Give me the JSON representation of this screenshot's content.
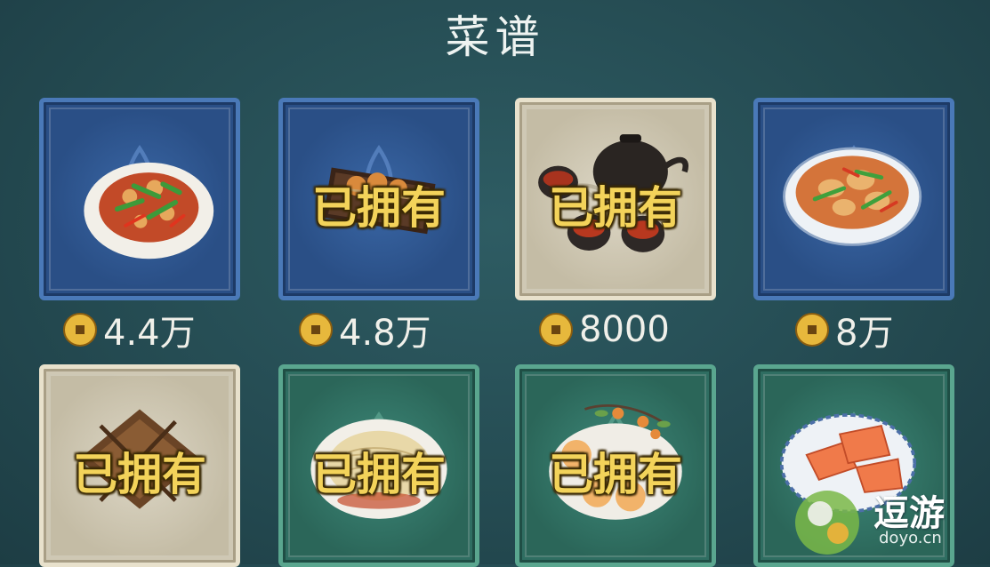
{
  "title": "菜谱",
  "owned_label": "已拥有",
  "recipes": [
    {
      "price": "4.4万",
      "owned": false,
      "frame": "blue"
    },
    {
      "price": "4.8万",
      "owned": true,
      "frame": "blue"
    },
    {
      "price": "8000",
      "owned": true,
      "frame": "beige"
    },
    {
      "price": "8万",
      "owned": false,
      "frame": "blue"
    },
    {
      "owned": true,
      "frame": "beige"
    },
    {
      "owned": true,
      "frame": "teal"
    },
    {
      "owned": true,
      "frame": "teal"
    },
    {
      "owned": false,
      "frame": "teal"
    }
  ],
  "watermark": {
    "brand": "逗游",
    "site": "doyo.cn"
  },
  "colors": {
    "owned_text": "#f3d35a",
    "background": "#2a555c"
  },
  "icons": [
    "coin-icon",
    "lotus-pattern",
    "dish-image"
  ]
}
